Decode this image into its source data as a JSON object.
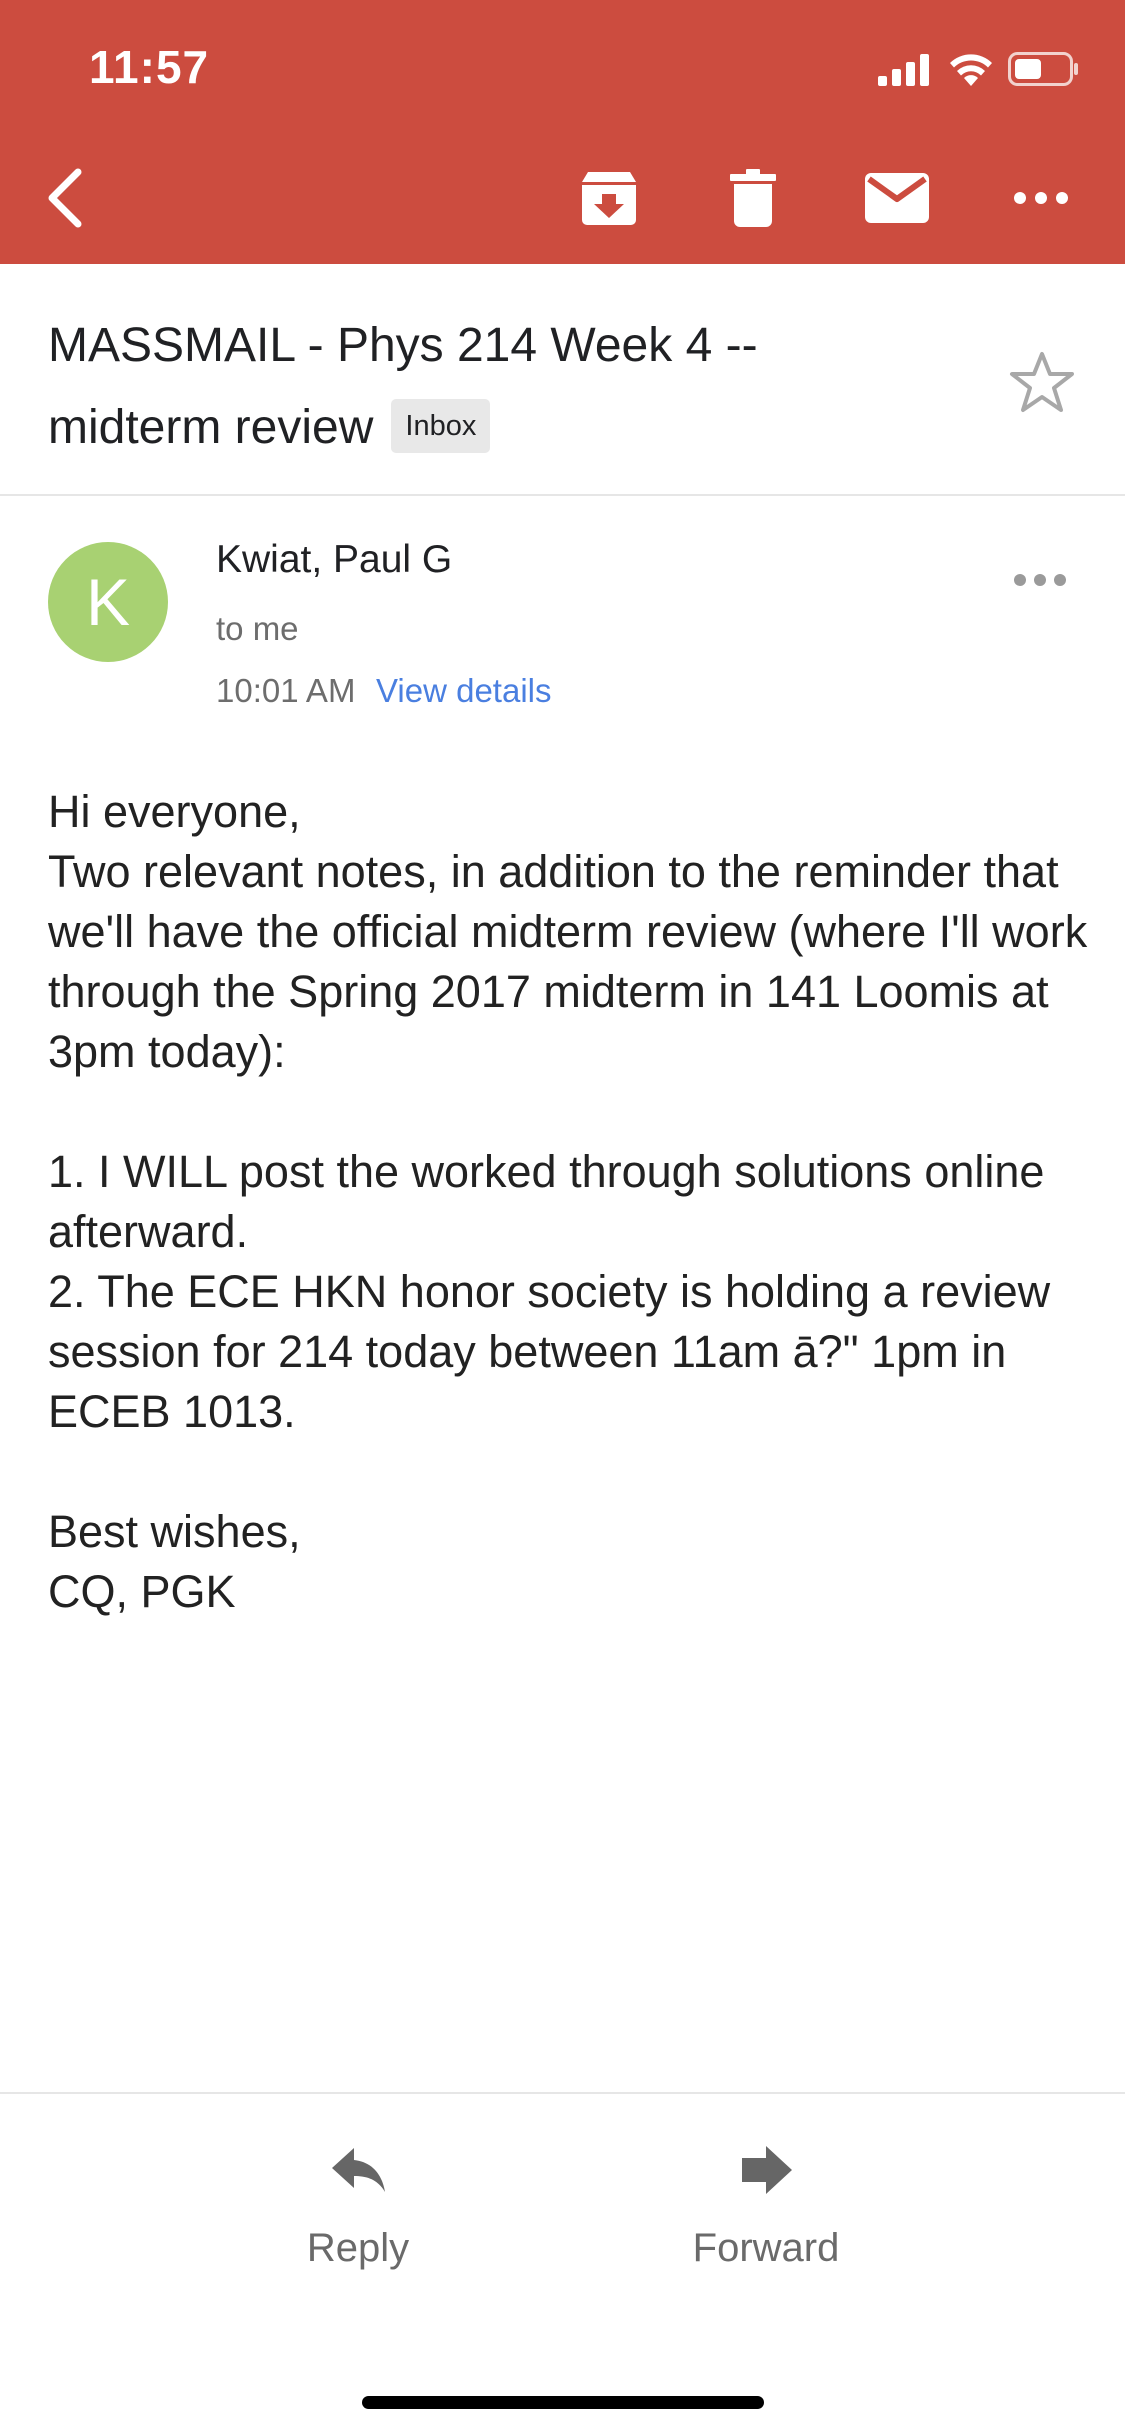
{
  "status_bar": {
    "time": "11:57",
    "icons": [
      "cellular-signal-icon",
      "wifi-icon",
      "battery-icon"
    ]
  },
  "toolbar": {
    "color": "#cc4c3f",
    "buttons": [
      "back-arrow-icon",
      "archive-icon",
      "trash-icon",
      "mail-icon",
      "more-horizontal-icon"
    ]
  },
  "email": {
    "subject_line1": "MASSMAIL - Phys 214 Week 4 --",
    "subject_line2": "midterm review",
    "label": "Inbox",
    "starred": false,
    "sender": {
      "initial": "K",
      "avatar_color": "#a8d172",
      "name": "Kwiat, Paul G",
      "recipient": "to me",
      "time": "10:01 AM",
      "details_link": "View details"
    },
    "body": [
      "Hi everyone,",
      "Two relevant notes, in addition to the reminder that we'll have the official midterm review (where I'll work through the Spring 2017 midterm in 141 Loomis at 3pm today):",
      "",
      "1. I WILL post the worked through solutions online afterward.",
      "2. The ECE HKN honor society is holding a review session for 214 today between 11am ā?\" 1pm in ECEB 1013.",
      "",
      "Best wishes,",
      "CQ, PGK"
    ]
  },
  "footer": {
    "reply_label": "Reply",
    "forward_label": "Forward"
  }
}
